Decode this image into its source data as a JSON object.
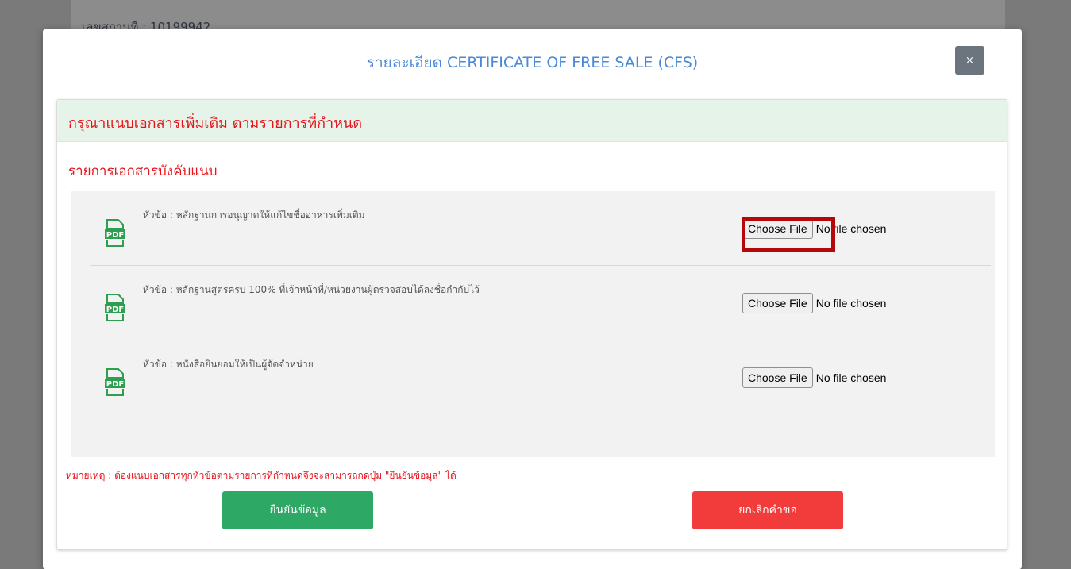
{
  "background": {
    "location_id_text": "เลขสถานที่ : 10199942"
  },
  "modal": {
    "title": "รายละเอียด CERTIFICATE OF FREE SALE (CFS)",
    "close_label": "×"
  },
  "panel": {
    "heading": "กรุณาแนบเอกสารเพิ่มเติม ตามรายการที่กำหนด",
    "section_title": "รายการเอกสารบังคับแนบ",
    "documents": [
      {
        "label": "หัวข้อ : หลักฐานการอนุญาตให้แก้ไขชื่ออาหารเพิ่มเติม",
        "icon": "pdf-icon",
        "button_label": "Choose File",
        "file_status": "No file chosen"
      },
      {
        "label": "หัวข้อ : หลักฐานสูตรครบ 100% ที่เจ้าหน้าที่/หน่วยงานผู้ตรวจสอบได้ลงชื่อกำกับไว้",
        "icon": "pdf-icon",
        "button_label": "Choose File",
        "file_status": "No file chosen"
      },
      {
        "label": "หัวข้อ : หนังสือยินยอมให้เป็นผู้จัดจำหน่าย",
        "icon": "pdf-icon",
        "button_label": "Choose File",
        "file_status": "No file chosen"
      }
    ],
    "note": "หมายเหตุ : ต้องแนบเอกสารทุกหัวข้อตามรายการที่กำหนดจึงจะสามารถกดปุ่ม \"ยืนยันข้อมูล\" ได้",
    "confirm_label": "ยืนยันข้อมูล",
    "cancel_label": "ยกเลิกคำขอ"
  },
  "colors": {
    "title_blue": "#4a89d6",
    "alert_red": "#e8141b",
    "confirm_green": "#2ea865",
    "cancel_red": "#f23b3b",
    "highlight": "#b5080d",
    "pdf_green": "#2e9e4f"
  }
}
